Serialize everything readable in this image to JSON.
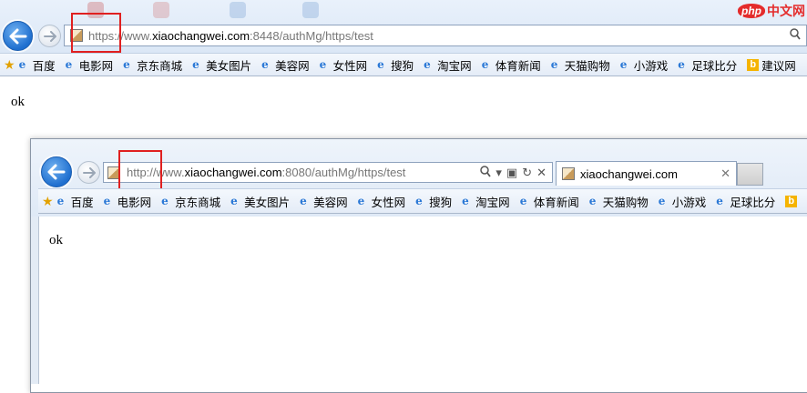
{
  "outer": {
    "address": {
      "scheme": "https://",
      "www": "www.",
      "host": "xiaochangwei.com",
      "rest": ":8448/authMg/https/test"
    },
    "page_text": "ok"
  },
  "favorites": [
    "百度",
    "电影网",
    "京东商城",
    "美女图片",
    "美容网",
    "女性网",
    "搜狗",
    "淘宝网",
    "体育新闻",
    "天猫购物",
    "小游戏",
    "足球比分",
    "建议网"
  ],
  "inner": {
    "address": {
      "scheme": "http://",
      "www": "www.",
      "host": "xiaochangwei.com",
      "rest": ":8080/authMg/https/test"
    },
    "tab_title": "xiaochangwei.com",
    "favorites": [
      "百度",
      "电影网",
      "京东商城",
      "美女图片",
      "美容网",
      "女性网",
      "搜狗",
      "淘宝网",
      "体育新闻",
      "天猫购物",
      "小游戏",
      "足球比分"
    ],
    "page_text": "ok"
  },
  "watermark": {
    "badge": "php",
    "text": "中文网"
  },
  "icons": {
    "back": "back-arrow-icon",
    "forward": "forward-arrow-icon",
    "search": "search-icon",
    "refresh": "refresh-icon",
    "stop": "stop-icon",
    "favorites": "favorites-star-icon",
    "ie": "ie-page-icon",
    "bing": "bing-icon"
  },
  "colors": {
    "highlight": "#e02020",
    "accent": "#1f6fcf"
  }
}
